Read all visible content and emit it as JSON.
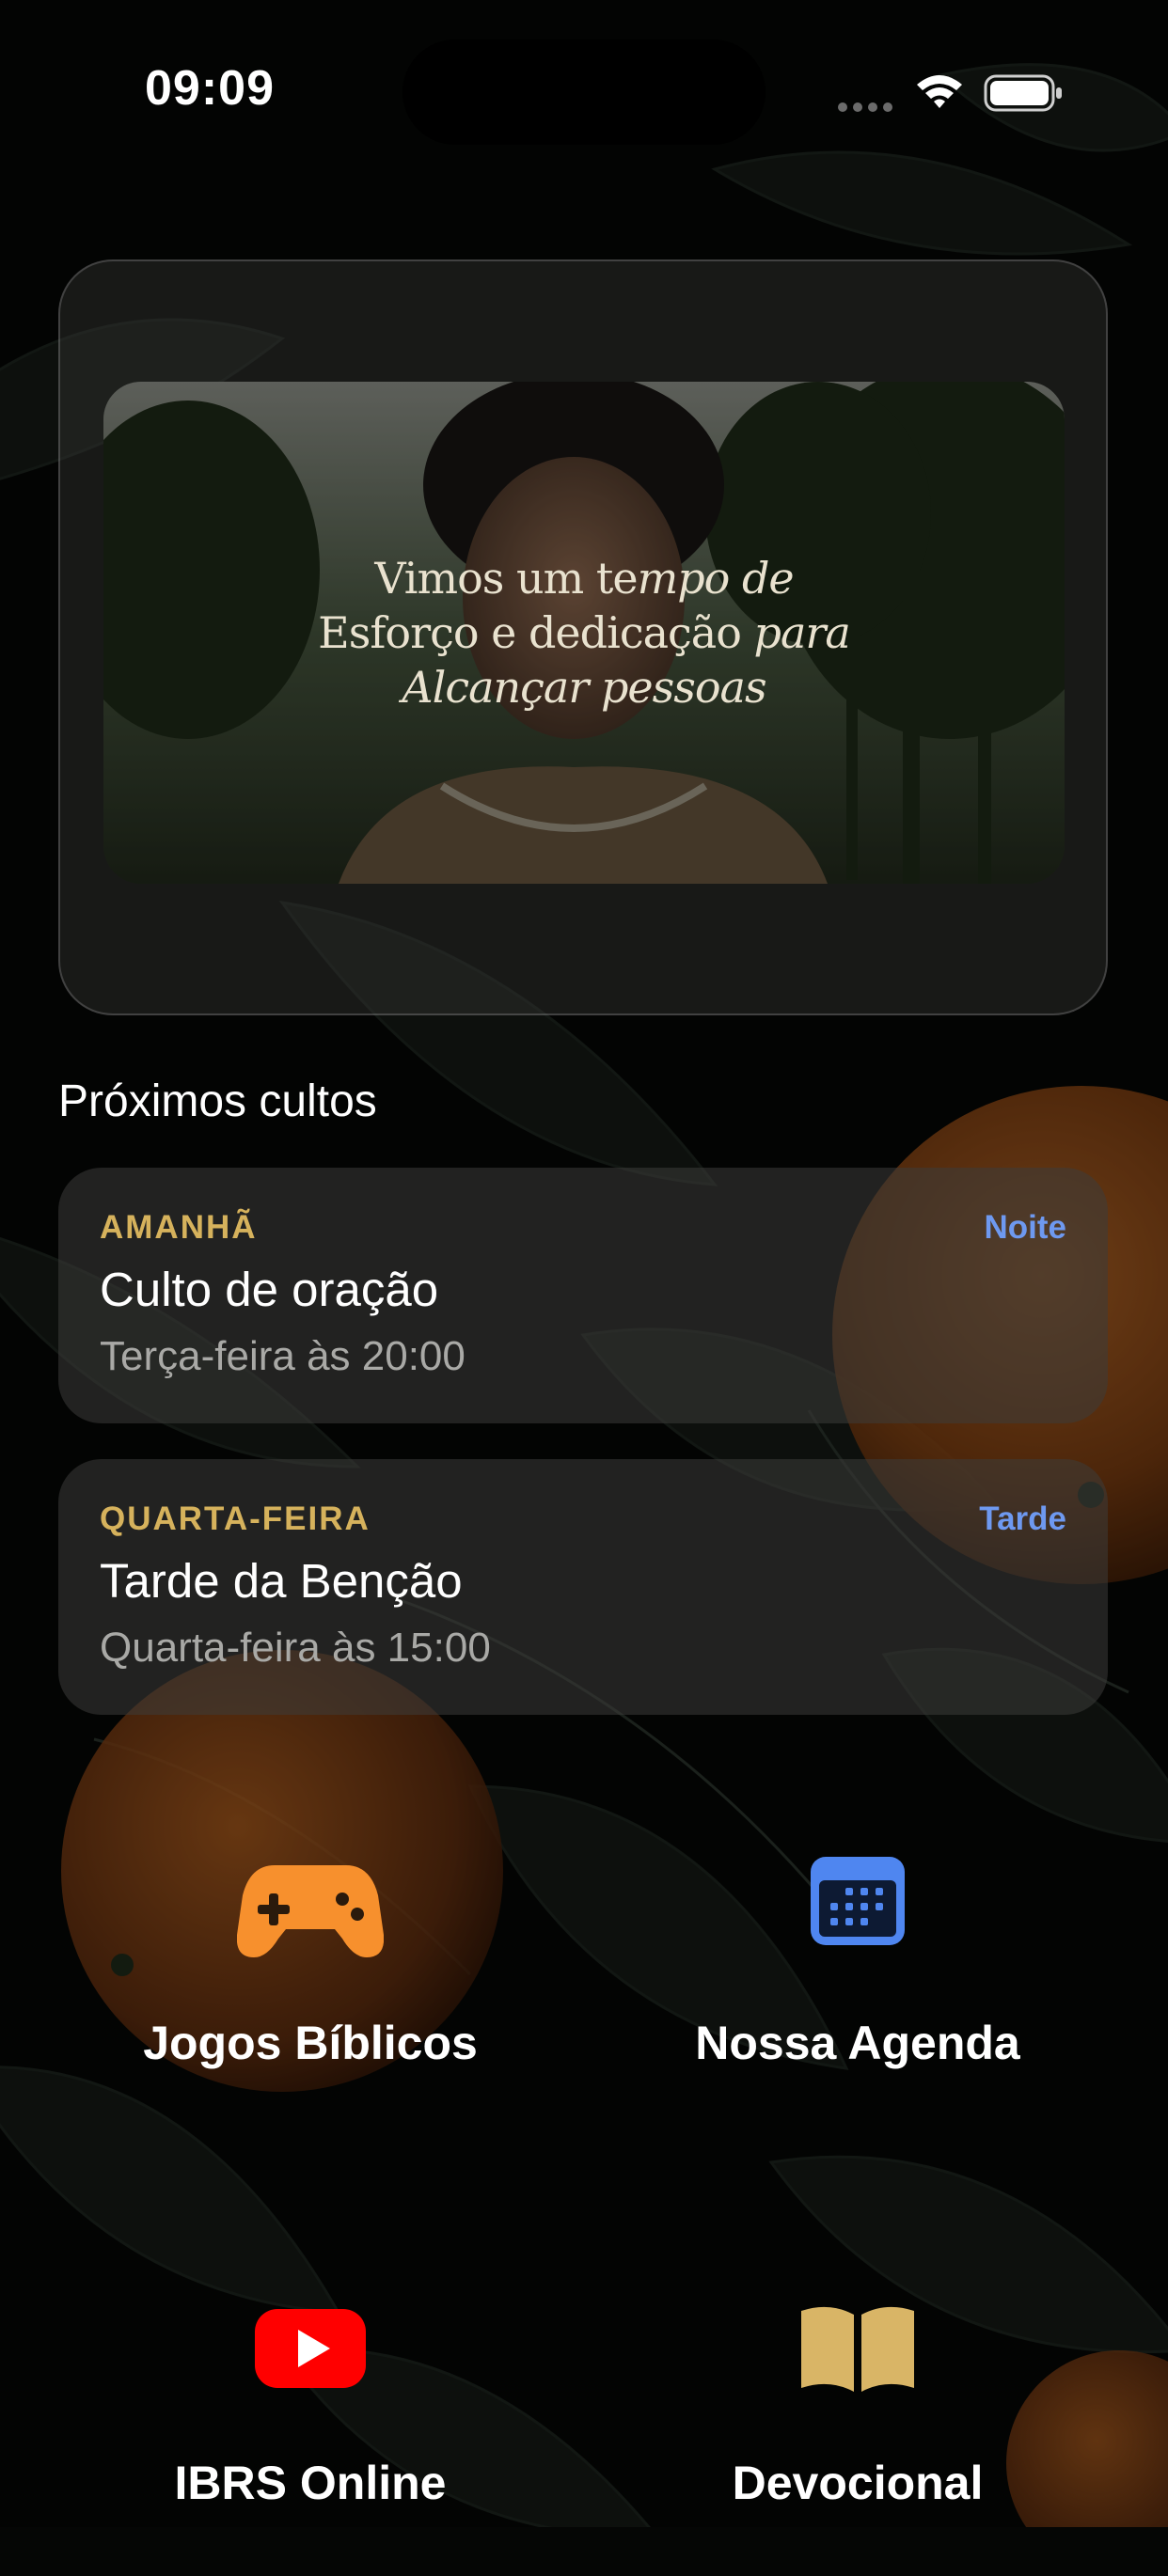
{
  "status_bar": {
    "time": "09:09"
  },
  "hero": {
    "caption": {
      "line1_regular": "Vimos um te",
      "line1_italic": "mpo de",
      "line2_regular": "Esforço e dedicação ",
      "line2_italic": "para",
      "line3_italic": "Alcançar pessoas"
    }
  },
  "upcoming": {
    "title": "Próximos cultos",
    "services": [
      {
        "day": "AMANHÃ",
        "period": "Noite",
        "name": "Culto de oração",
        "schedule": "Terça-feira às 20:00"
      },
      {
        "day": "QUARTA-FEIRA",
        "period": "Tarde",
        "name": "Tarde da Benção",
        "schedule": "Quarta-feira às 15:00"
      }
    ]
  },
  "shortcuts": [
    {
      "label": "Jogos Bíblicos",
      "icon": "gamecontroller-icon"
    },
    {
      "label": "Nossa Agenda",
      "icon": "calendar-icon"
    },
    {
      "label": "IBRS Online",
      "icon": "youtube-icon"
    },
    {
      "label": "Devocional",
      "icon": "book-icon"
    }
  ],
  "colors": {
    "day_label": "#d6b25c",
    "period_label": "#6e99f0",
    "game_icon": "#f7902d",
    "calendar_icon": "#4f86f0",
    "youtube_icon": "#ff0000",
    "book_icon": "#d9b566"
  }
}
